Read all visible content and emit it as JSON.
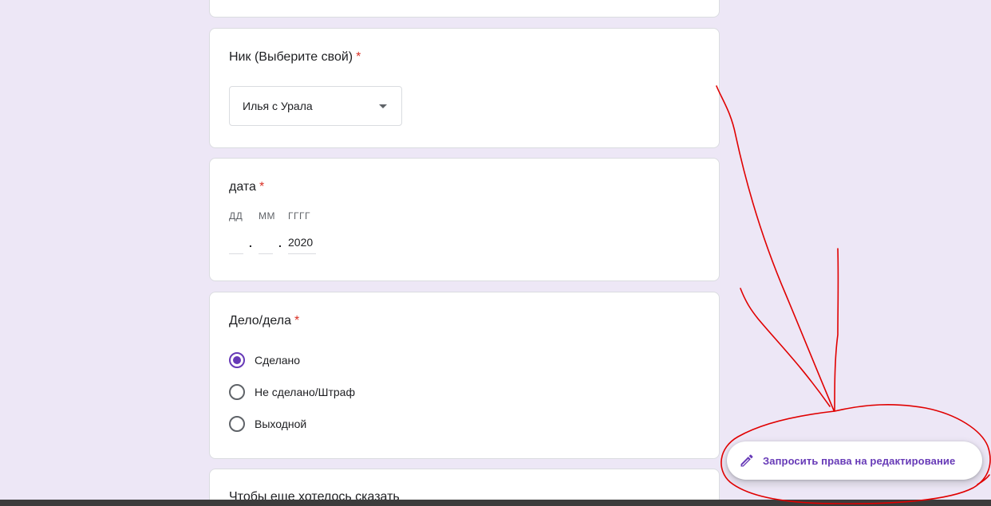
{
  "questions": {
    "nick": {
      "title": "Ник (Выберите свой)",
      "required_mark": "*",
      "selected": "Илья с Урала"
    },
    "date": {
      "title": "дата",
      "required_mark": "*",
      "day_label": "ДД",
      "month_label": "ММ",
      "year_label": "ГГГГ",
      "day_value": "",
      "month_value": "",
      "year_value": "2020",
      "separator": "."
    },
    "deals": {
      "title": "Дело/дела",
      "required_mark": "*",
      "options": [
        {
          "label": "Сделано",
          "checked": true
        },
        {
          "label": "Не сделано/Штраф",
          "checked": false
        },
        {
          "label": "Выходной",
          "checked": false
        }
      ]
    },
    "next": {
      "title": "Чтобы еще хотелось сказать"
    }
  },
  "fab": {
    "label": "Запросить права на редактирование",
    "icon": "pencil-icon"
  },
  "colors": {
    "background": "#ede7f6",
    "accent": "#673ab7",
    "required": "#d93025",
    "annotation": "#e00000"
  }
}
